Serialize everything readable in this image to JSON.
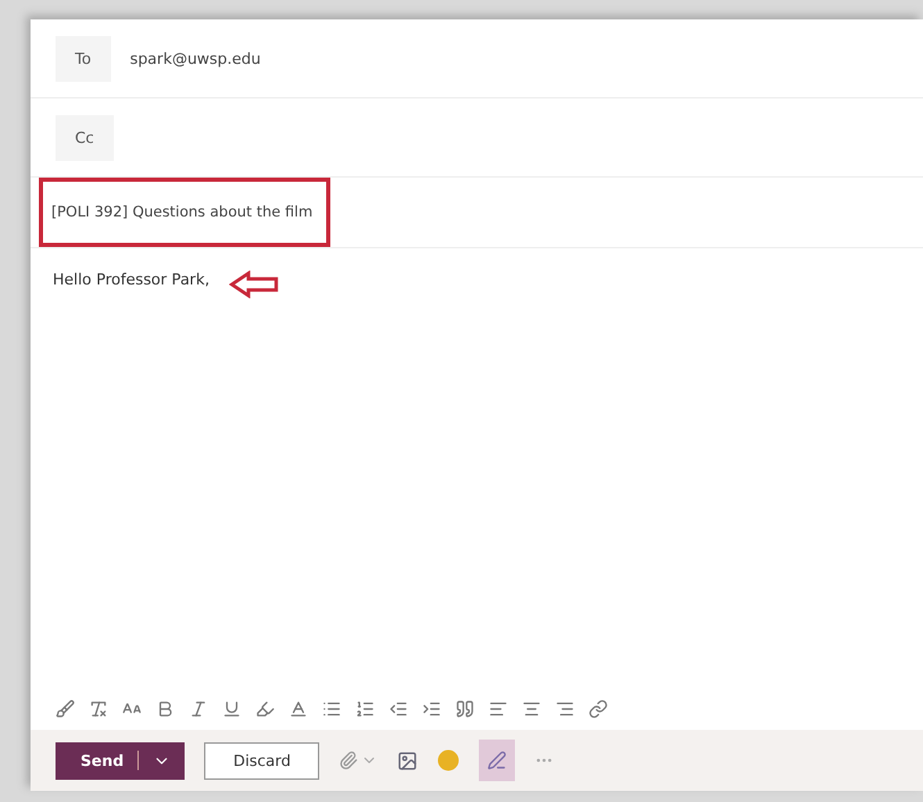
{
  "to": {
    "label": "To",
    "value": "spark@uwsp.edu"
  },
  "cc": {
    "label": "Cc"
  },
  "subject": {
    "value": "[POLI 392] Questions about the film",
    "highlighted": true
  },
  "body": {
    "text": "Hello Professor Park,",
    "arrow": true
  },
  "actions": {
    "send": "Send",
    "discard": "Discard",
    "ink_selected": true
  }
}
